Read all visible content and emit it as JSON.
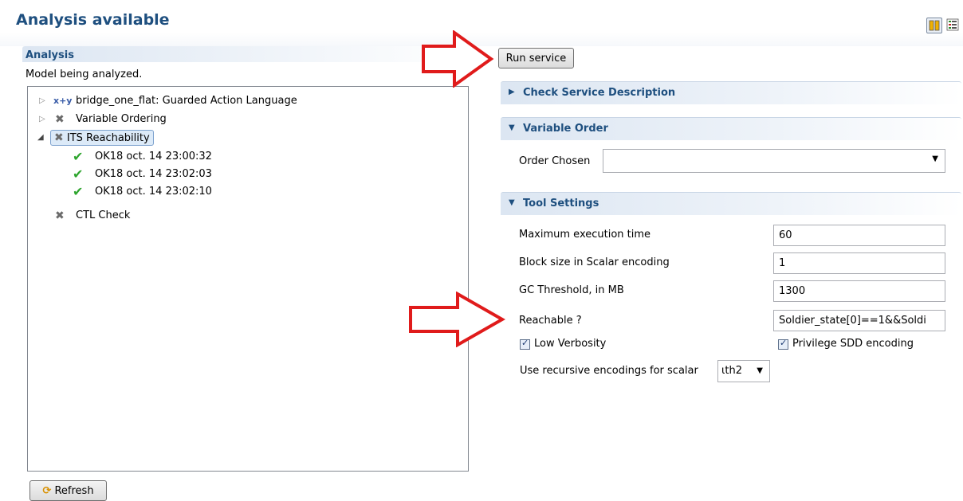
{
  "page": {
    "title": "Analysis available"
  },
  "analysis": {
    "title": "Analysis",
    "description": "Model being analyzed.",
    "tree": [
      {
        "label": "bridge_one_flat: Guarded Action Language",
        "icon": "xy-icon",
        "icon_text": "x+y"
      },
      {
        "label": "Variable Ordering",
        "icon": "x-icon"
      },
      {
        "label": "ITS Reachability",
        "icon": "x-icon"
      },
      {
        "label": "OK18 oct. 14 23:00:32",
        "icon": "check-icon"
      },
      {
        "label": "OK18 oct. 14 23:02:03",
        "icon": "check-icon"
      },
      {
        "label": "OK18 oct. 14 23:02:10",
        "icon": "check-icon"
      },
      {
        "label": "CTL Check",
        "icon": "x-icon"
      }
    ]
  },
  "buttons": {
    "run_service": "Run service",
    "refresh": "Refresh"
  },
  "sections": {
    "check_service": "Check Service Description",
    "variable_order": "Variable Order",
    "tool_settings": "Tool Settings"
  },
  "variable_order": {
    "label": "Order Chosen",
    "value": ""
  },
  "tool_settings": {
    "max_exec_label": "Maximum execution time",
    "max_exec_value": "60",
    "block_size_label": "Block size in Scalar encoding",
    "block_size_value": "1",
    "gc_label": "GC Threshold, in MB",
    "gc_value": "1300",
    "reachable_label": "Reachable ?",
    "reachable_value": "Soldier_state[0]==1&&Soldi",
    "low_verbosity": "Low Verbosity",
    "privilege_sdd": "Privilege SDD encoding",
    "recursive_label": "Use recursive encodings for scalar",
    "recursive_value": "ɩth2"
  },
  "colors": {
    "accent": "#1e4f7f",
    "annotation_arrow": "#e01b1b"
  }
}
